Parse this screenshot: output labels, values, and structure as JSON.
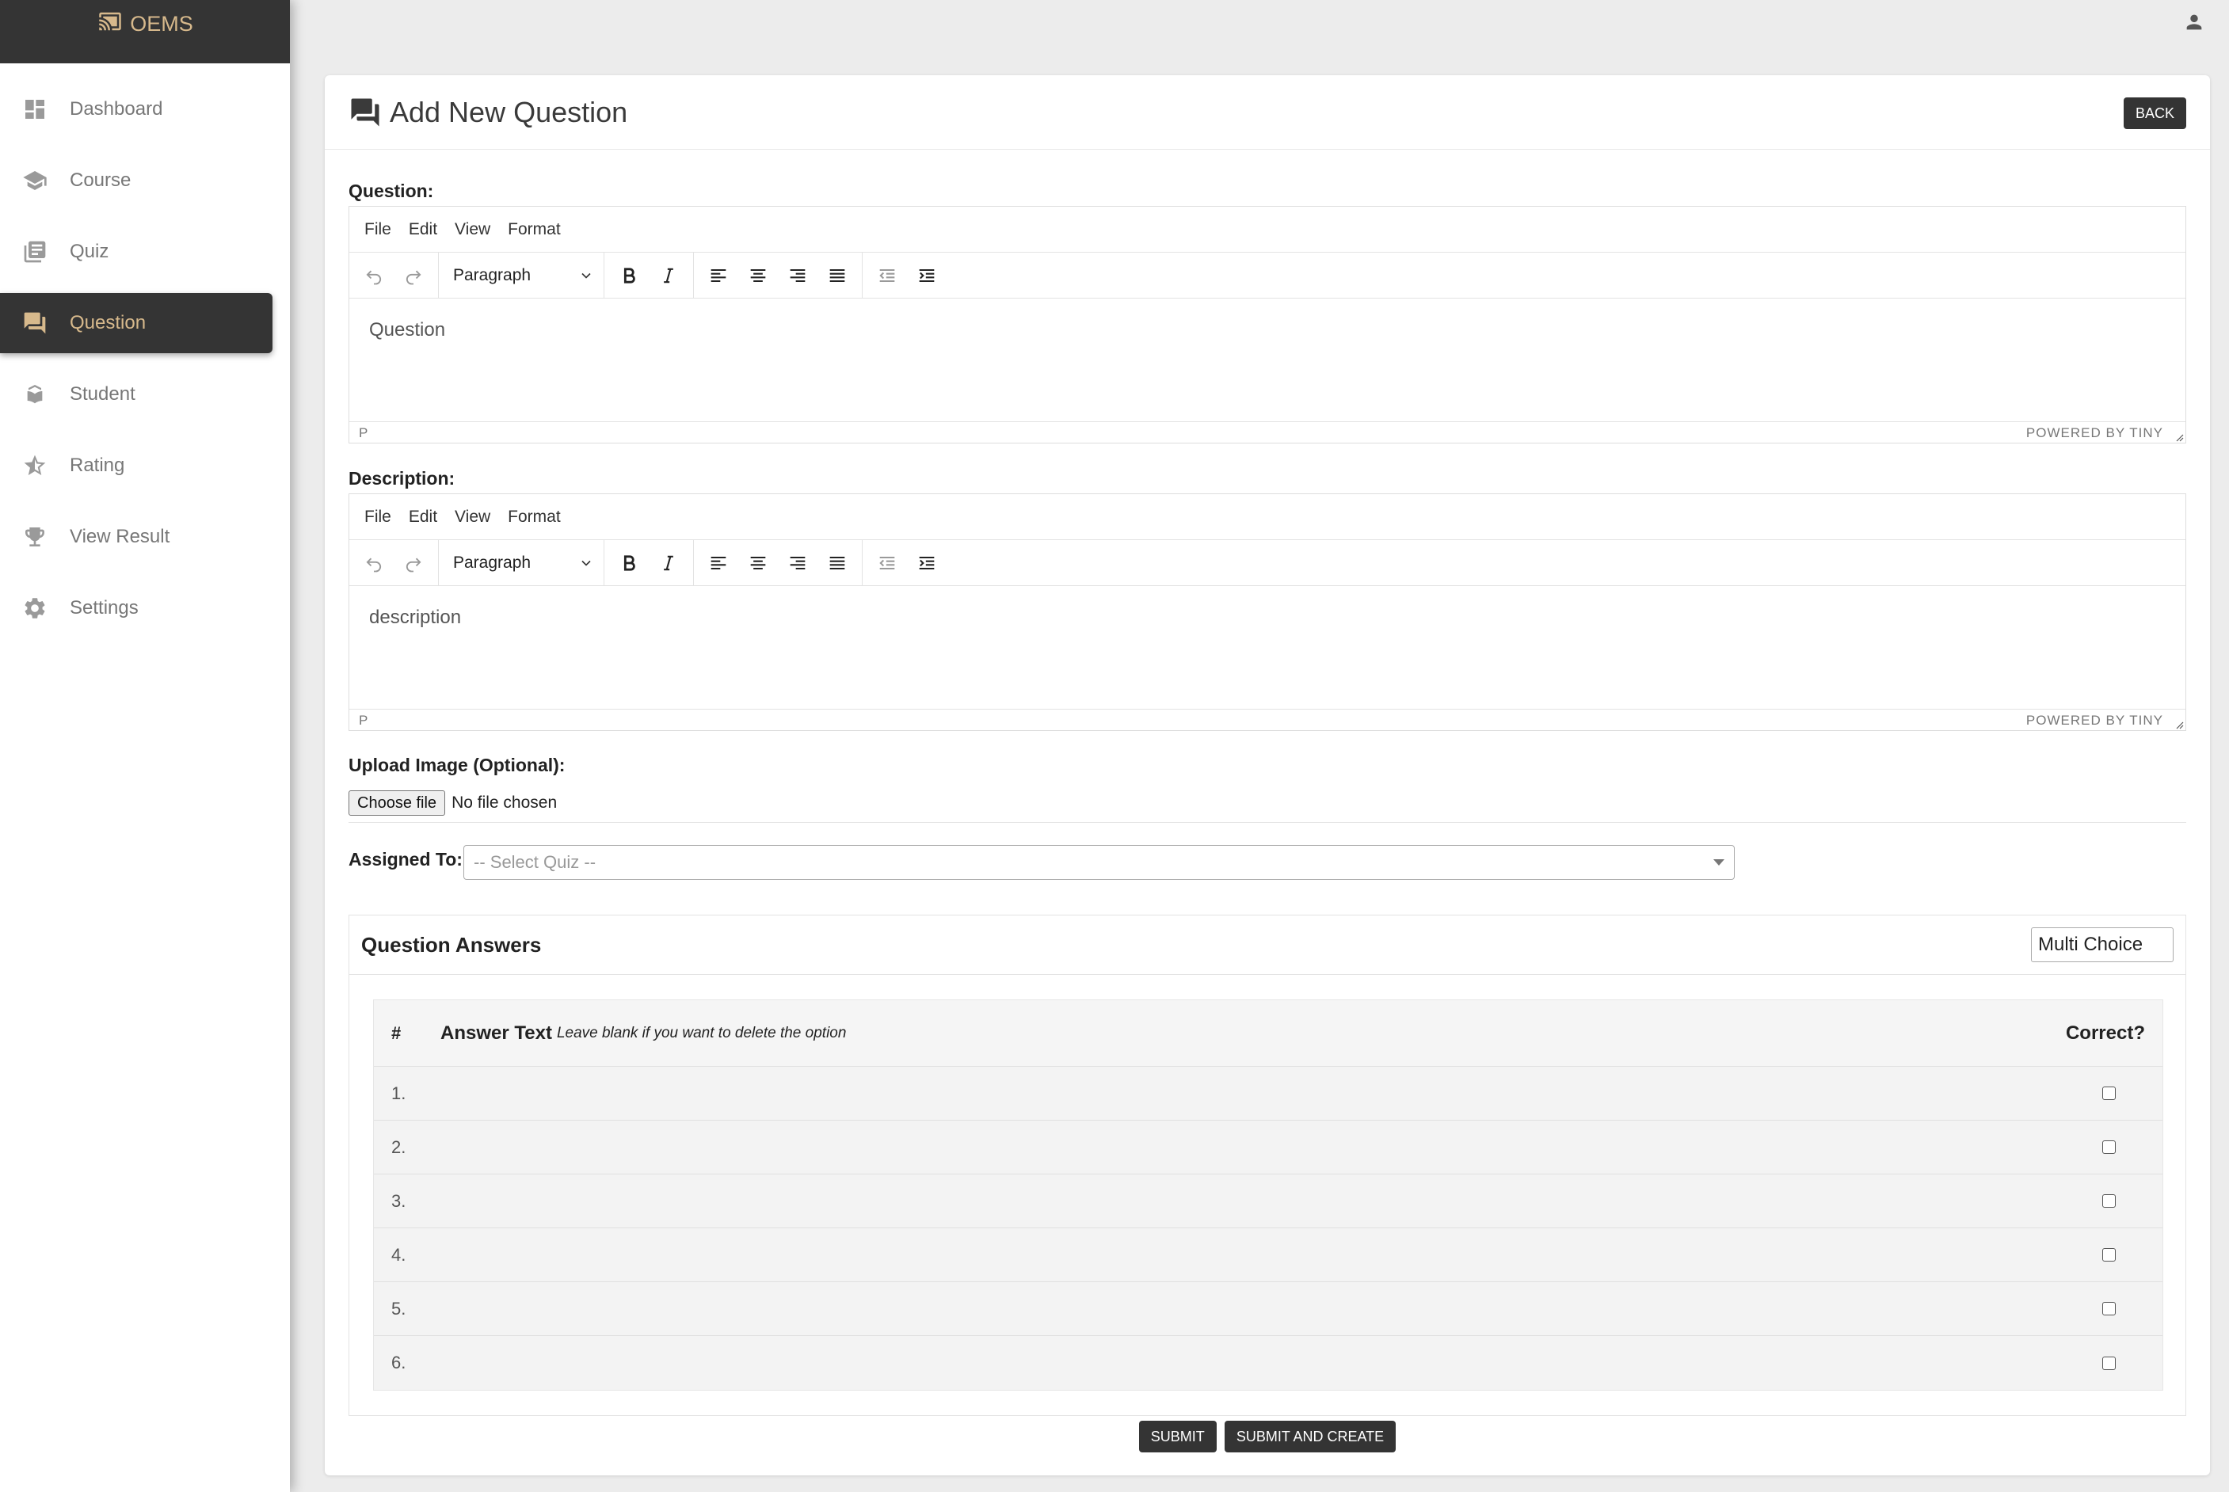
{
  "brand": {
    "name": "OEMS"
  },
  "sidebar": {
    "items": [
      {
        "label": "Dashboard",
        "icon": "dashboard-icon"
      },
      {
        "label": "Course",
        "icon": "graduation-cap-icon"
      },
      {
        "label": "Quiz",
        "icon": "library-books-icon"
      },
      {
        "label": "Question",
        "icon": "forum-icon",
        "active": true
      },
      {
        "label": "Student",
        "icon": "student-icon"
      },
      {
        "label": "Rating",
        "icon": "star-icon"
      },
      {
        "label": "View Result",
        "icon": "trophy-icon"
      },
      {
        "label": "Settings",
        "icon": "gear-icon"
      }
    ]
  },
  "header": {
    "title": "Add New Question",
    "back_label": "BACK"
  },
  "question_editor": {
    "label": "Question:",
    "menu": [
      "File",
      "Edit",
      "View",
      "Format"
    ],
    "block_format": "Paragraph",
    "placeholder": "Question",
    "status_path": "P",
    "powered_by": "POWERED BY TINY"
  },
  "description_editor": {
    "label": "Description:",
    "menu": [
      "File",
      "Edit",
      "View",
      "Format"
    ],
    "block_format": "Paragraph",
    "placeholder": "description",
    "status_path": "P",
    "powered_by": "POWERED BY TINY"
  },
  "upload": {
    "label": "Upload Image (Optional):",
    "button_label": "Choose file",
    "status": "No file chosen"
  },
  "assigned": {
    "label": "Assigned To:",
    "placeholder": "-- Select Quiz --"
  },
  "answers": {
    "title": "Question Answers",
    "type_value": "Multi Choice",
    "col_num": "#",
    "col_text": "Answer Text",
    "col_hint": "Leave blank if you want to delete the option",
    "col_correct": "Correct?",
    "rows": [
      "1.",
      "2.",
      "3.",
      "4.",
      "5.",
      "6."
    ]
  },
  "actions": {
    "submit_label": "SUBMIT",
    "submit_create_label": "SUBMIT AND CREATE"
  },
  "colors": {
    "accent": "#d7b98c",
    "dark": "#343434",
    "background": "#ececec"
  }
}
